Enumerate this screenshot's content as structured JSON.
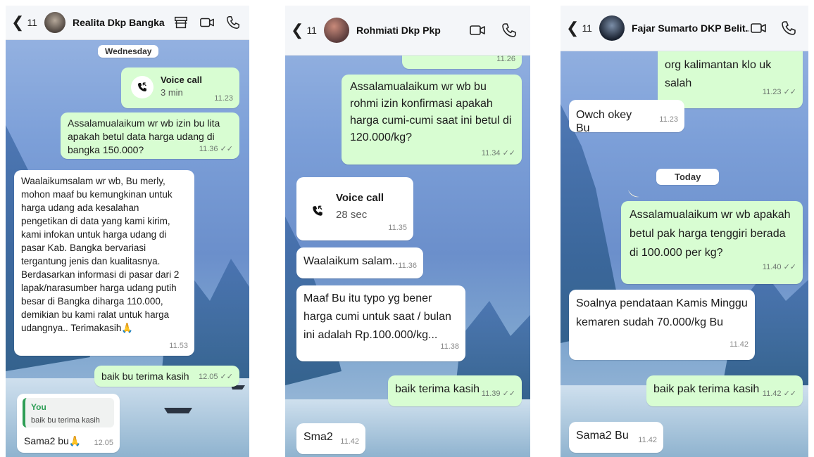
{
  "panels": [
    {
      "back": "❮",
      "count": "11",
      "contact": "Realita Dkp Bangka",
      "day_label": "Wednesday",
      "voice_call": {
        "label": "Voice call",
        "duration": "3 min",
        "time": "11.23"
      },
      "messages": [
        {
          "dir": "out",
          "text": "Assalamualaikum wr wb izin bu lita apakah betul data harga udang di bangka 150.000?",
          "time": "11.36 ✓✓"
        },
        {
          "dir": "in",
          "text": "Waalaikumsalam wr wb, Bu merly, mohon maaf bu kemungkinan untuk harga udang ada kesalahan pengetikan di data yang kami kirim, kami infokan untuk harga udang di  pasar Kab. Bangka bervariasi tergantung jenis dan kualitasnya. Berdasarkan informasi di pasar dari 2 lapak/narasumber harga udang putih besar di Bangka diharga 110.000, demikian bu kami ralat untuk harga udangnya.. Terimakasih🙏",
          "time": "11.53"
        },
        {
          "dir": "out",
          "text": "baik bu terima kasih",
          "time": "12.05 ✓✓"
        }
      ],
      "reply": {
        "quote_name": "You",
        "quote_text": "baik bu terima kasih",
        "text": "Sama2 bu🙏",
        "time": "12.05"
      }
    },
    {
      "back": "❮",
      "count": "11",
      "contact": "Rohmiati Dkp Pkp",
      "top_time": "11.26",
      "voice_call": {
        "label": "Voice call",
        "duration": "28 sec",
        "time": "11.35"
      },
      "messages": [
        {
          "dir": "out",
          "text": "Assalamualaikum wr wb bu rohmi izin konfirmasi apakah harga cumi-cumi saat ini betul di 120.000/kg?",
          "time": "11.34 ✓✓"
        },
        {
          "dir": "in",
          "text": "Waalaikum salam..",
          "time": "11.36"
        },
        {
          "dir": "in",
          "text": "Maaf Bu itu typo yg bener harga cumi untuk saat / bulan ini adalah Rp.100.000/kg...",
          "time": "11.38"
        },
        {
          "dir": "out",
          "text": "baik terima kasih",
          "time": "11.39 ✓✓"
        },
        {
          "dir": "in",
          "text": "Sma2",
          "time": "11.42"
        }
      ]
    },
    {
      "back": "❮",
      "count": "11",
      "contact": "Fajar Sumarto DKP Belit...",
      "day_label": "Today",
      "messages": [
        {
          "dir": "out",
          "text": "org kalimantan klo uk salah",
          "time": "11.23 ✓✓"
        },
        {
          "dir": "in",
          "text": "Owch okey Bu",
          "time": "11.23"
        },
        {
          "dir": "out",
          "text": "Assalamualaikum wr wb apakah betul pak harga tenggiri berada di 100.000 per kg?",
          "time": "11.40 ✓✓"
        },
        {
          "dir": "in",
          "text": "Soalnya pendataan Kamis Minggu kemaren sudah 70.000/kg Bu",
          "time": "11.42"
        },
        {
          "dir": "out",
          "text": "baik pak terima kasih",
          "time": "11.42 ✓✓"
        },
        {
          "dir": "in",
          "text": "Sama2 Bu",
          "time": "11.42"
        }
      ]
    }
  ],
  "icons": {
    "back": "chevron-left-icon",
    "store": "store-icon",
    "video": "video-call-icon",
    "phone": "phone-icon",
    "call": "incoming-call-icon"
  },
  "colors": {
    "outgoing": "#d8fdd2",
    "incoming": "#ffffff",
    "header": "#f4f6f9",
    "quote_accent": "#2e9e56"
  }
}
